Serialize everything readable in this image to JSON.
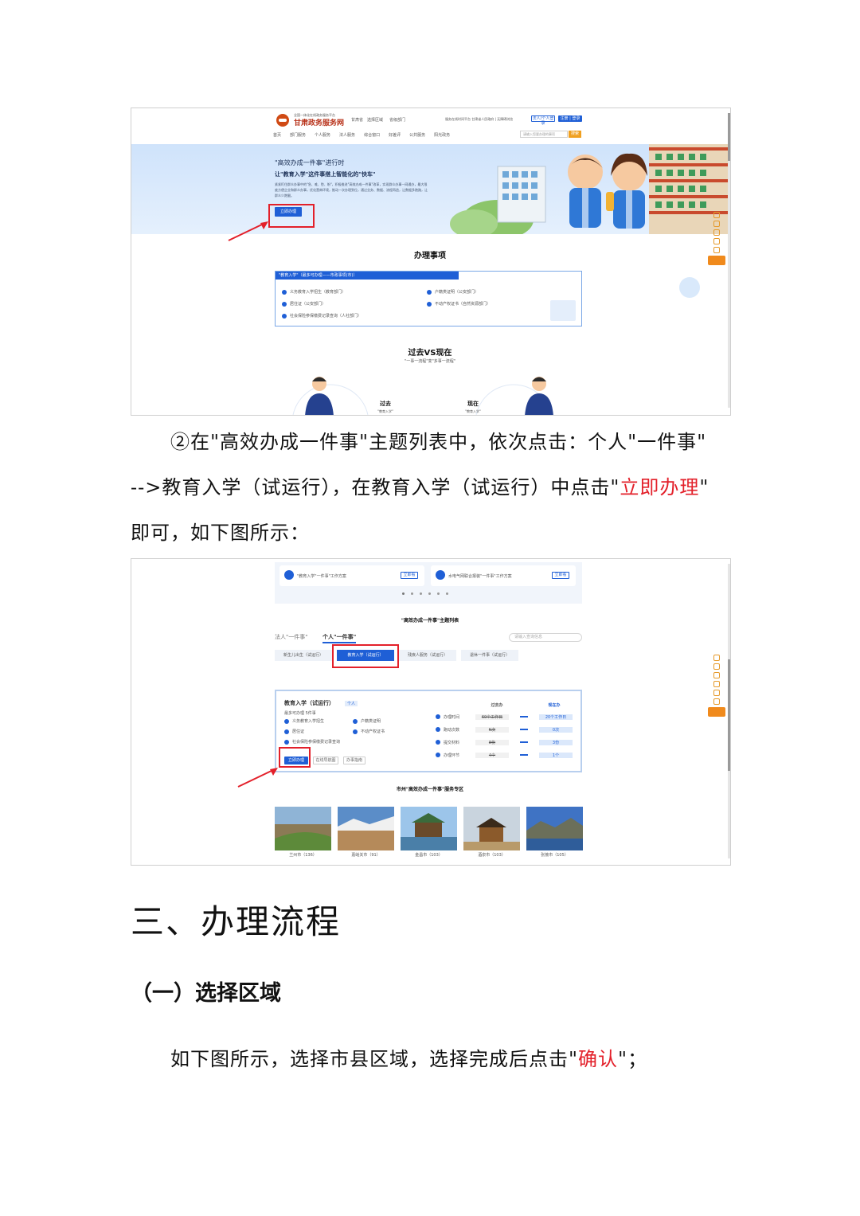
{
  "screenshot1": {
    "site_tagline": "全国一体化在线政务服务平台",
    "site_title": "甘肃政务服务网",
    "region": "甘肃省",
    "region_switch": "选择区域",
    "dept_switch": "省级部门",
    "top_links": "服务在线时间平台 甘肃省人民政府 | 无障碍浏览",
    "login_btn": "法人/个人登录",
    "register_btn": "注册 | 登录",
    "nav": [
      "首页",
      "部门服务",
      "个人服务",
      "法人服务",
      "综合窗口",
      "好差评",
      "公共服务",
      "阳光政务"
    ],
    "search_placeholder": "请输入您要办理的事项",
    "search_btn": "搜索",
    "banner_kicker": "\"高效办成一件事\"进行时",
    "banner_title": "让\"教育入学\"这件事搭上智能化的\"快车\"",
    "banner_desc": "紧紧盯住群众办事中的\"急、难、愁、盼\"，积极推进\"高效办成一件事\"改革，实现群众办事一网通办，最大限度方便企业和群众办事，优化营商环境，推动一次办理到位，通过业务、数据、流程再造，让数据多跑路，让群众少跑腿。",
    "banner_btn": "立即办理",
    "section_title": "办理事项",
    "card_header": "\"教育入学\"（最多可办理——市政事项(市)）",
    "items_left": [
      "义务教育入学招生（教育部门）",
      "居住证（公安部门）",
      "社会保险参保缴费记录查询（人社部门）"
    ],
    "items_right": [
      "户籍类证明（公安部门）",
      "不动产权证书（自然资源部门）"
    ],
    "compare_title": "过去VS现在",
    "compare_sub": "\"一事一流程\"变\"多事一流程\"",
    "past_label": "过去",
    "past_sub": "\"教育入学\"",
    "now_label": "现在",
    "now_sub": "\"教育入学\""
  },
  "instruction": {
    "line1_prefix": "②在\"高效办成一件事\"主题列表中，依次点击：个人\"一件事\"",
    "line2_prefix": "-->教育入学（试运行），在教育入学（试运行）中点击\"",
    "line2_red": "立即办理",
    "line2_suffix": "\"",
    "line3": "即可，如下图所示："
  },
  "screenshot2": {
    "plan1": "\"教育入学\"一件事\"工作方案",
    "plan1_btn": "立即看",
    "plan2": "水电气网联合报装\"一件事\"工作方案",
    "plan2_btn": "立即看",
    "list_title": "\"高效办成一件事\"主题列表",
    "tab_legal": "法人\"一件事\"",
    "tab_personal": "个人\"一件事\"",
    "search_placeholder": "请输入查询信息",
    "subtabs": [
      "新生儿出生（试运行）",
      "教育入学（试运行）",
      "残疾人服务（试运行）",
      "退休一件事（试运行）"
    ],
    "detail_title": "教育入学（试运行）",
    "detail_badge": "个人",
    "detail_count": "最多可办理 5件事",
    "detail_items_left": [
      "义务教育入学招生",
      "居住证",
      "社会保险参保缴费记录查询"
    ],
    "detail_items_right": [
      "户籍类证明",
      "不动产权证书"
    ],
    "detail_btn_apply": "立即办理",
    "detail_btn_guide": "在线导航图",
    "detail_btn_help": "办事指南",
    "compare_head_past": "过去办",
    "compare_head_now": "现在办",
    "compare_rows": [
      {
        "label": "办理时间",
        "past": "60个工作日",
        "now": "20个工作日"
      },
      {
        "label": "跑动次数",
        "past": "5次",
        "now": "0次"
      },
      {
        "label": "提交材料",
        "past": "8份",
        "now": "3份"
      },
      {
        "label": "办理环节",
        "past": "4个",
        "now": "1个"
      }
    ],
    "zone_title": "市州\"高效办成一件事\"服务专区",
    "cities": [
      "兰州市（136）",
      "嘉峪关市（91）",
      "金昌市（103）",
      "酒泉市（103）",
      "张掖市（105）"
    ]
  },
  "heading1": "三、办理流程",
  "heading2": "（一）选择区域",
  "final": {
    "prefix": "如下图所示，选择市县区域，选择完成后点击\"",
    "red": "确认",
    "suffix": "\"；"
  }
}
